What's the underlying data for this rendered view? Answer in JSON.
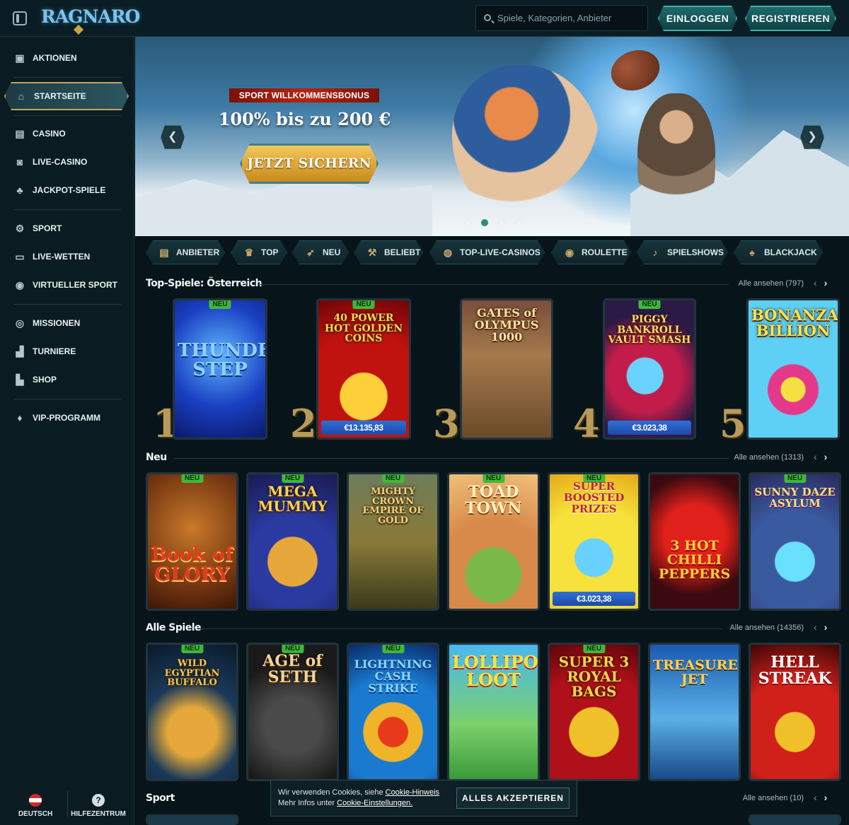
{
  "header": {
    "logo": "RAGNARO",
    "search_placeholder": "Spiele, Kategorien, Anbieter",
    "login_label": "EINLOGGEN",
    "register_label": "REGISTRIEREN"
  },
  "sidebar": {
    "items": [
      {
        "label": "AKTIONEN",
        "icon": "gift-icon"
      },
      {
        "label": "STARTSEITE",
        "icon": "home-icon"
      },
      {
        "label": "CASINO",
        "icon": "slot-machine-icon"
      },
      {
        "label": "LIVE-CASINO",
        "icon": "live-dealer-icon"
      },
      {
        "label": "JACKPOT-SPIELE",
        "icon": "clover-icon"
      },
      {
        "label": "SPORT",
        "icon": "soccer-ball-icon"
      },
      {
        "label": "LIVE-WETTEN",
        "icon": "live-tv-icon"
      },
      {
        "label": "VIRTUELLER SPORT",
        "icon": "virtual-sport-icon"
      },
      {
        "label": "MISSIONEN",
        "icon": "target-icon"
      },
      {
        "label": "TURNIERE",
        "icon": "podium-icon"
      },
      {
        "label": "SHOP",
        "icon": "shop-basket-icon"
      },
      {
        "label": "VIP-PROGRAMM",
        "icon": "diamond-icon"
      }
    ],
    "footer": {
      "language_label": "DEUTSCH",
      "help_label": "HILFEZENTRUM",
      "help_glyph": "?"
    }
  },
  "hero": {
    "tag": "SPORT WILLKOMMENSBONUS",
    "headline": "100% bis zu 200 €",
    "cta": "JETZT SICHERN",
    "arrow_prev": "❮",
    "arrow_next": "❯",
    "slides": 4,
    "active_slide": 2
  },
  "categories": [
    {
      "label": "ANBIETER",
      "icon": "scroll-icon"
    },
    {
      "label": "TOP",
      "icon": "trophy-icon"
    },
    {
      "label": "NEU",
      "icon": "rocket-icon"
    },
    {
      "label": "BELIEBT",
      "icon": "hammer-icon"
    },
    {
      "label": "TOP-LIVE-CASINOS",
      "icon": "chip-icon"
    },
    {
      "label": "ROULETTE",
      "icon": "roulette-icon"
    },
    {
      "label": "SPIELSHOWS",
      "icon": "microphone-icon"
    },
    {
      "label": "BLACKJACK",
      "icon": "cards-icon"
    }
  ],
  "sections": {
    "top": {
      "title": "Top-Spiele: Österreich",
      "see_all": "Alle ansehen (797)",
      "games": [
        {
          "rank": "1",
          "name": "THUNDER STEP",
          "badge": "NEU",
          "jackpot": ""
        },
        {
          "rank": "2",
          "name": "40 POWER HOT GOLDEN COINS",
          "badge": "NEU",
          "jackpot": "€13.135,83"
        },
        {
          "rank": "3",
          "name": "GATES of OLYMPUS 1000",
          "badge": "",
          "jackpot": ""
        },
        {
          "rank": "4",
          "name": "PIGGY BANKROLL VAULT SMASH",
          "badge": "NEU",
          "jackpot": "€3.023,38"
        },
        {
          "rank": "5",
          "name": "BONANZA BILLION",
          "badge": "",
          "jackpot": ""
        }
      ]
    },
    "new": {
      "title": "Neu",
      "see_all": "Alle ansehen (1313)",
      "games": [
        {
          "name": "Book of GLORY",
          "badge": "NEU",
          "jackpot": ""
        },
        {
          "name": "MEGA MUMMY",
          "badge": "NEU",
          "jackpot": ""
        },
        {
          "name": "MIGHTY CROWN EMPIRE OF GOLD",
          "badge": "NEU",
          "jackpot": ""
        },
        {
          "name": "TOAD TOWN",
          "badge": "NEU",
          "jackpot": ""
        },
        {
          "name": "SUPER BOOSTED PRIZES",
          "badge": "NEU",
          "jackpot": "€3.023,38"
        },
        {
          "name": "3 HOT CHILLI PEPPERS",
          "badge": "NEU",
          "jackpot": ""
        },
        {
          "name": "SUNNY DAZE ASYLUM",
          "badge": "NEU",
          "jackpot": ""
        }
      ]
    },
    "all": {
      "title": "Alle Spiele",
      "see_all": "Alle ansehen (14356)",
      "games": [
        {
          "name": "WILD EGYPTIAN BUFFALO",
          "badge": "NEU"
        },
        {
          "name": "AGE of SETH",
          "badge": "NEU"
        },
        {
          "name": "LIGHTNING CASH STRIKE",
          "badge": "NEU"
        },
        {
          "name": "LOLLIPOP LOOT",
          "badge": ""
        },
        {
          "name": "SUPER 3 ROYAL BAGS",
          "badge": "NEU"
        },
        {
          "name": "TREASURE JET",
          "badge": ""
        },
        {
          "name": "HELL STREAK",
          "badge": ""
        }
      ]
    },
    "sport": {
      "title": "Sport",
      "see_all": "Alle ansehen (10)"
    }
  },
  "cookie": {
    "line1_prefix": "Wir verwenden Cookies, siehe ",
    "line1_link": "Cookie-Hinweis",
    "line2_prefix": "Mehr Infos unter ",
    "line2_link": "Cookie-Einstellungen.",
    "accept_label": "ALLES AKZEPTIEREN"
  },
  "pager": {
    "prev": "‹",
    "next": "›"
  },
  "colors": {
    "accent": "#3bb3a8",
    "gold": "#c3a55a",
    "new_badge": "#3fb83a",
    "jackpot": "#2f6fd6"
  }
}
